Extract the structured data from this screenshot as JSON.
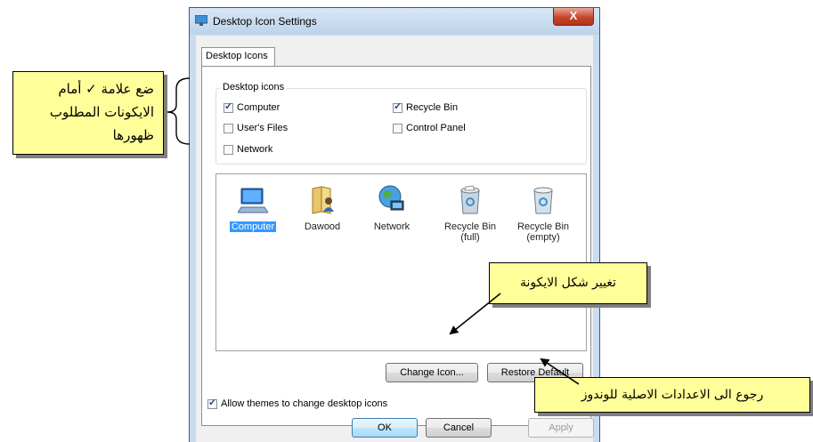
{
  "window": {
    "title": "Desktop Icon Settings",
    "close_glyph": "X",
    "app_icon": "desktop-settings-icon"
  },
  "tab": {
    "label": "Desktop Icons"
  },
  "group": {
    "legend": "Desktop icons",
    "checkboxes": [
      {
        "label": "Computer",
        "checked": true
      },
      {
        "label": "User's Files",
        "checked": false
      },
      {
        "label": "Network",
        "checked": false
      },
      {
        "label": "Recycle Bin",
        "checked": true
      },
      {
        "label": "Control Panel",
        "checked": false
      }
    ]
  },
  "icons": [
    {
      "label": "Computer",
      "icon": "computer-icon",
      "selected": true
    },
    {
      "label": "Dawood",
      "icon": "user-folder-icon",
      "selected": false
    },
    {
      "label": "Network",
      "icon": "network-icon",
      "selected": false
    },
    {
      "label": "Recycle Bin\n(full)",
      "icon": "recycle-bin-full-icon",
      "selected": false
    },
    {
      "label": "Recycle Bin\n(empty)",
      "icon": "recycle-bin-empty-icon",
      "selected": false
    }
  ],
  "buttons": {
    "change_icon": "Change Icon...",
    "restore_default": "Restore Default",
    "ok": "OK",
    "cancel": "Cancel",
    "apply": "Apply"
  },
  "allow_themes": {
    "label": "Allow themes to change desktop icons",
    "checked": true
  },
  "annotations": {
    "checkmark_note": {
      "line1": "ضع علامة ✓ أمام",
      "line2": "الايكونات المطلوب",
      "line3": "ظهورها"
    },
    "change_icon_note": "تغيير شكل الايكونة",
    "restore_note": "رجوع الى الاعدادات الاصلية للوندوز"
  },
  "colors": {
    "note_background": "#ffff99",
    "selection": "#3399ff",
    "close_button": "#c6462c"
  }
}
